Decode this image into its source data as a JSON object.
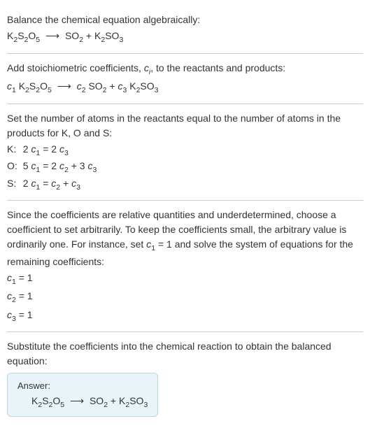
{
  "section1": {
    "title": "Balance the chemical equation algebraically:",
    "eq_lhs": "K",
    "eq_s1": "2",
    "eq_s": "S",
    "eq_s2": "2",
    "eq_o": "O",
    "eq_s3": "5",
    "arrow": "⟶",
    "eq_rhs1": "SO",
    "eq_r1s": "2",
    "plus": " + ",
    "eq_rhs2": "K",
    "eq_r2s1": "2",
    "eq_rhs2b": "SO",
    "eq_r2s2": "3"
  },
  "section2": {
    "title_a": "Add stoichiometric coefficients, ",
    "title_c": "c",
    "title_i": "i",
    "title_b": ", to the reactants and products:",
    "c1": "c",
    "c1s": "1",
    "sp": " ",
    "k": "K",
    "s2": "2",
    "s": "S",
    "s2b": "2",
    "o": "O",
    "s5": "5",
    "arrow": "⟶",
    "c2": "c",
    "c2s": "2",
    "so": "SO",
    "so2": "2",
    "plus": " + ",
    "c3": "c",
    "c3s": "3",
    "k2": "K",
    "k2s": "2",
    "so3": "SO",
    "so3s": "3"
  },
  "section3": {
    "title": "Set the number of atoms in the reactants equal to the number of atoms in the products for K, O and S:",
    "rows": [
      {
        "label": "K:",
        "lhs_coef": "2 ",
        "lhs_c": "c",
        "lhs_s": "1",
        "eq": " = ",
        "r1_coef": "2 ",
        "r1_c": "c",
        "r1_s": "3",
        "plus": "",
        "r2_coef": "",
        "r2_c": "",
        "r2_s": ""
      },
      {
        "label": "O:",
        "lhs_coef": "5 ",
        "lhs_c": "c",
        "lhs_s": "1",
        "eq": " = ",
        "r1_coef": "2 ",
        "r1_c": "c",
        "r1_s": "2",
        "plus": " + ",
        "r2_coef": "3 ",
        "r2_c": "c",
        "r2_s": "3"
      },
      {
        "label": "S:",
        "lhs_coef": "2 ",
        "lhs_c": "c",
        "lhs_s": "1",
        "eq": " = ",
        "r1_coef": "",
        "r1_c": "c",
        "r1_s": "2",
        "plus": " + ",
        "r2_coef": "",
        "r2_c": "c",
        "r2_s": "3"
      }
    ]
  },
  "section4": {
    "text_a": "Since the coefficients are relative quantities and underdetermined, choose a coefficient to set arbitrarily. To keep the coefficients small, the arbitrary value is ordinarily one. For instance, set ",
    "c": "c",
    "cs": "1",
    "text_b": " = 1 and solve the system of equations for the remaining coefficients:",
    "eqs": [
      {
        "c": "c",
        "s": "1",
        "val": " = 1"
      },
      {
        "c": "c",
        "s": "2",
        "val": " = 1"
      },
      {
        "c": "c",
        "s": "3",
        "val": " = 1"
      }
    ]
  },
  "section5": {
    "title": "Substitute the coefficients into the chemical reaction to obtain the balanced equation:",
    "answer_label": "Answer:",
    "k": "K",
    "s2": "2",
    "s": "S",
    "s2b": "2",
    "o": "O",
    "s5": "5",
    "arrow": "⟶",
    "so": "SO",
    "so2": "2",
    "plus": " + ",
    "k2": "K",
    "k2s": "2",
    "so3": "SO",
    "so3s": "3"
  }
}
